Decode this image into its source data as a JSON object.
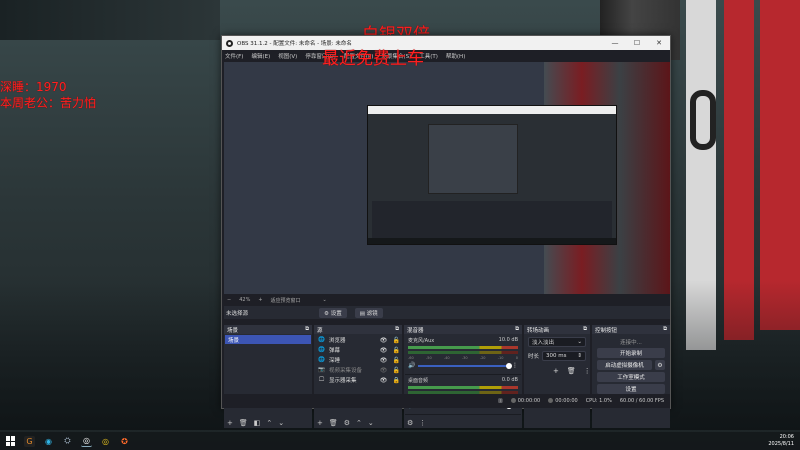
{
  "overlay": {
    "top_line1": "白银双倍",
    "top_line2": "最近免费上车",
    "left_line1": "深睡：1970",
    "left_line2": "本周老公：苦力怕"
  },
  "window": {
    "title": "OBS 31.1.2 - 配置文件: 未命名 - 场景: 未命名",
    "minimize": "—",
    "maximize": "☐",
    "close": "✕"
  },
  "menu": [
    "文件(F)",
    "编辑(E)",
    "视图(V)",
    "停靠窗口(D)",
    "配置文件(P)",
    "场景集合(S)",
    "工具(T)",
    "帮助(H)"
  ],
  "preview_strip": {
    "zoom_prefix": "−",
    "zoom": "42%",
    "plus": "+",
    "mode": "适应预览窗口",
    "mode_arrow": "⌄"
  },
  "context_bar": {
    "no_source": "未选择源",
    "properties": "设置",
    "filters": "滤镜"
  },
  "docks": {
    "scenes": {
      "title": "场景",
      "items": [
        "场景"
      ]
    },
    "sources": {
      "title": "源",
      "items": [
        {
          "name": "浏览器",
          "icon": "🌐",
          "dim": false
        },
        {
          "name": "弹幕",
          "icon": "🌐",
          "dim": false
        },
        {
          "name": "深睡",
          "icon": "🌐",
          "dim": false
        },
        {
          "name": "视频采集设备",
          "icon": "📷",
          "dim": true
        },
        {
          "name": "显示器采集",
          "icon": "🖵",
          "dim": false
        }
      ]
    },
    "mixer": {
      "title": "混音器",
      "channels": [
        {
          "name": "麦克风/Aux",
          "db": "10.0 dB"
        },
        {
          "name": "桌面音频",
          "db": "0.0 dB"
        }
      ],
      "ticks": [
        "-60",
        "-55",
        "-50",
        "-45",
        "-40",
        "-35",
        "-30",
        "-25",
        "-20",
        "-15",
        "-10",
        "-5",
        "0"
      ]
    },
    "transitions": {
      "title": "转场动画",
      "type": "淡入淡出",
      "duration_label": "时长",
      "duration": "300 ms"
    },
    "controls": {
      "title": "控制按钮",
      "status": "连接中...",
      "start_recording": "开始录制",
      "virtual_camera": "启动虚拟摄像机",
      "studio_mode": "工作室模式",
      "settings": "设置"
    },
    "header_icons": {
      "float": "⧉",
      "more": "⋮"
    }
  },
  "status": {
    "stream_time": "00:00:00",
    "rec_time": "00:00:00",
    "cpu": "CPU: 1.0%",
    "fps": "60.00 / 60.00 FPS"
  },
  "taskbar": {
    "time": "20:06",
    "date": "2025/8/11"
  },
  "colors": {
    "overlay_red": "#ff2020",
    "selected_scene": "#3c55b4",
    "slider": "#3a60c0"
  }
}
